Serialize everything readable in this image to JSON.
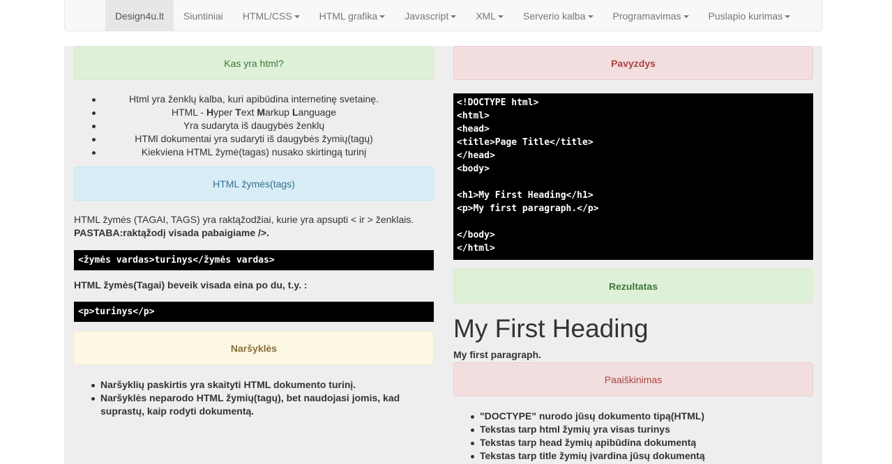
{
  "nav": {
    "items": [
      {
        "label": "Design4u.lt",
        "dropdown": false,
        "active": true
      },
      {
        "label": "Siuntiniai",
        "dropdown": false,
        "active": false
      },
      {
        "label": "HTML/CSS",
        "dropdown": true,
        "active": false
      },
      {
        "label": "HTML grafika",
        "dropdown": true,
        "active": false
      },
      {
        "label": "Javascript",
        "dropdown": true,
        "active": false
      },
      {
        "label": "XML",
        "dropdown": true,
        "active": false
      },
      {
        "label": "Serverio kalba",
        "dropdown": true,
        "active": false
      },
      {
        "label": "Programavimas",
        "dropdown": true,
        "active": false
      },
      {
        "label": "Puslapio kurimas",
        "dropdown": true,
        "active": false
      }
    ]
  },
  "left": {
    "what_is_html": "Kas yra html?",
    "intro_items": [
      "Html yra ženklų kalba, kuri apibūdina internetinę svetainę.",
      "Yra sudaryta iš daugybės ženklų",
      "HTMl dokumentai yra sudaryti iš daugybės žymių(tagų)",
      "Kiekviena HTML žymė(tagas) nusako skirtingą turinį"
    ],
    "acronym": {
      "prefix": "HTML - ",
      "h": "H",
      "h_rest": "yper ",
      "t": "T",
      "t_rest": "ext ",
      "m": "M",
      "m_rest": "arkup ",
      "l": "L",
      "l_rest": "anguage"
    },
    "tags_heading": "HTML žymės(tags)",
    "tags_text": "HTML žymės (TAGAI, TAGS) yra raktąžodžiai, kurie yra apsupti < ir > ženklais.",
    "note_label": "PASTABA:",
    "note_text": "raktąžodį visada pabaigiame />.",
    "tag_syntax": "<žymės vardas>turinys</žymės vardas>",
    "pairs_text": "HTML žymės(Tagai) beveik visada eina po du, t.y. :",
    "pair_example": "<p>turinys</p>",
    "browsers_heading": "Naršyklės",
    "browser_items": [
      "Naršyklių paskirtis yra skaityti HTML dokumento turinį.",
      "Naršyklės neparodo HTML žymių(tagų), bet naudojasi jomis, kad suprastų, kaip rodyti dokumentą."
    ]
  },
  "right": {
    "example_heading": "Pavyzdys",
    "code_lines": [
      "<!DOCTYPE html>",
      "<html>",
      "<head>",
      "<title>Page Title</title>",
      "</head>",
      "<body>",
      "",
      "<h1>My First Heading</h1>",
      "<p>My first paragraph.</p>",
      "",
      "</body>",
      "</html>"
    ],
    "result_heading": "Rezultatas",
    "result_h1": "My First Heading",
    "result_p": "My first paragraph.",
    "explain_heading": "Paaiškinimas",
    "explain_items": [
      "\"DOCTYPE\" nurodo jūsų dokumento tipą(HTML)",
      "Tekstas tarp html žymių yra visas turinys",
      "Tekstas tarp head žymių apibūdina dokumentą",
      "Tekstas tarp title žymių įvardina jūsų dokumentą"
    ]
  }
}
